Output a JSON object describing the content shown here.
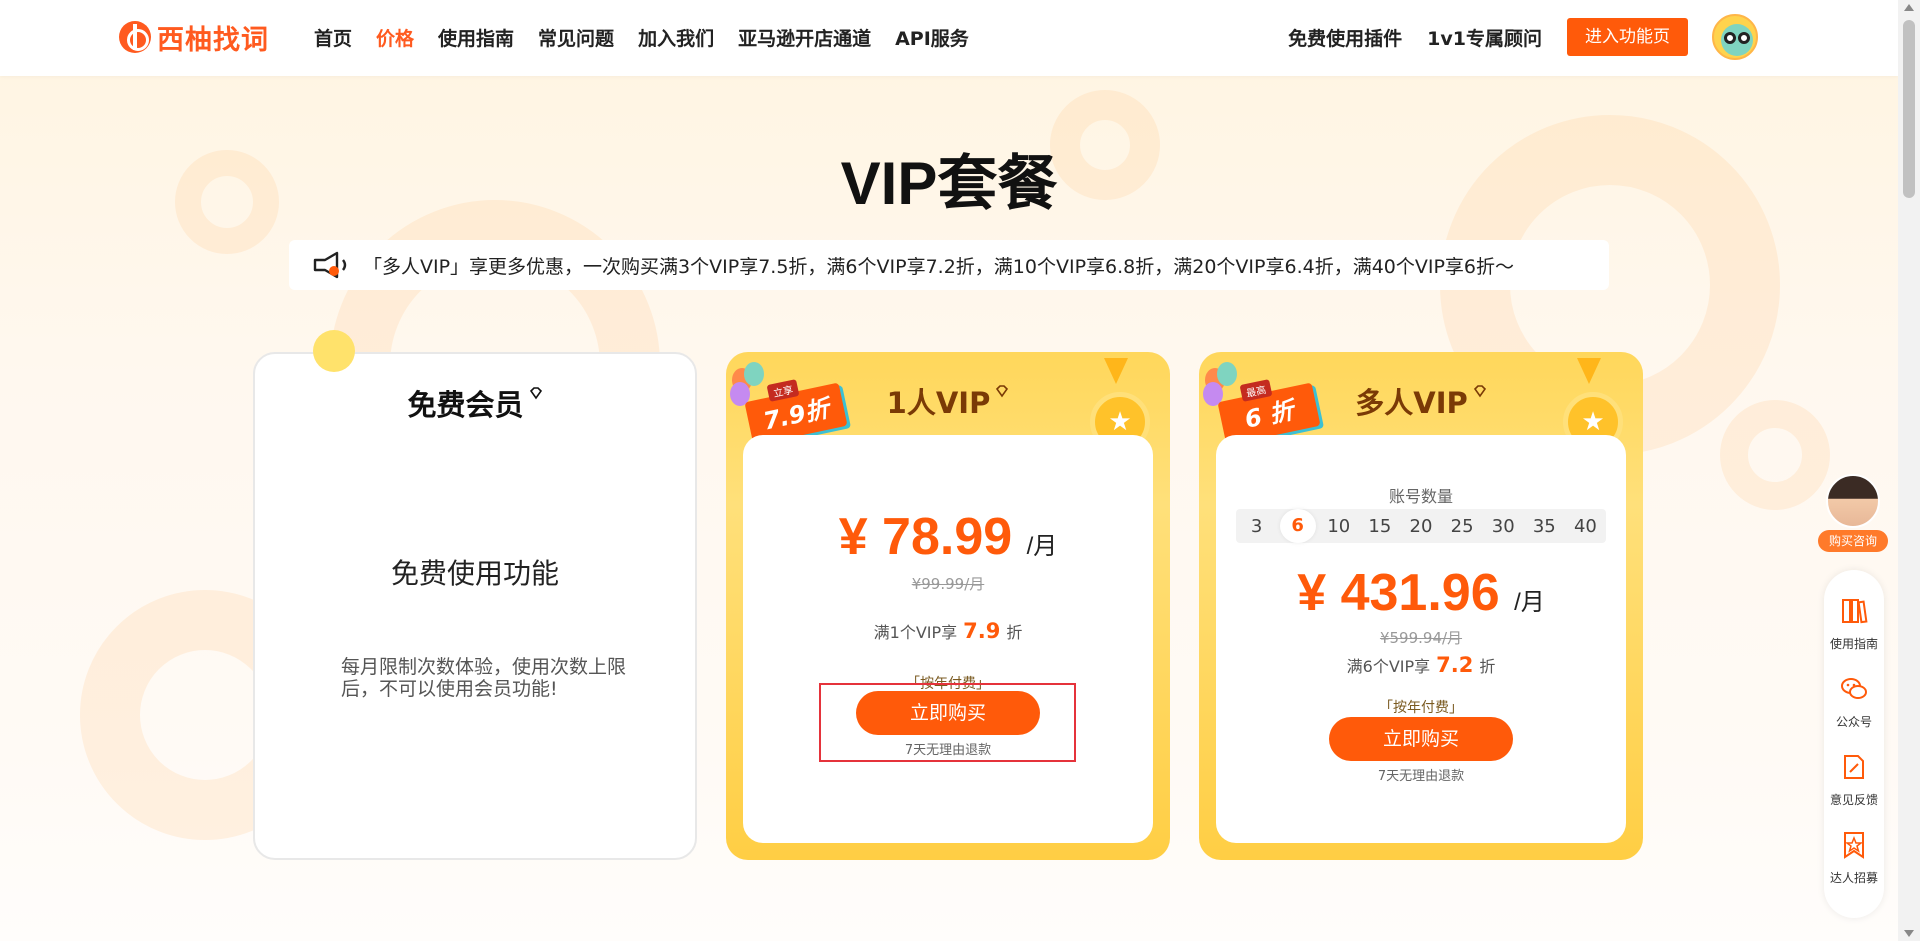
{
  "brand": {
    "name": "西柚找词",
    "color": "#ff5a1f"
  },
  "nav": {
    "items": [
      "首页",
      "价格",
      "使用指南",
      "常见问题",
      "加入我们",
      "亚马逊开店通道",
      "API服务"
    ],
    "active_index": 1
  },
  "header_right": {
    "plugin_link": "免费使用插件",
    "advisor_link": "1v1专属顾问",
    "enter_button": "进入功能页"
  },
  "page_title": "VIP套餐",
  "notice": {
    "icon": "megaphone-icon",
    "text": "「多人VIP」享更多优惠，一次购买满3个VIP享7.5折，满6个VIP享7.2折，满10个VIP享6.8折，满20个VIP享6.4折，满40个VIP享6折～"
  },
  "plans": {
    "free": {
      "title": "免费会员",
      "main": "免费使用功能",
      "desc": "每月限制次数体验，使用次数上限后，不可以使用会员功能!"
    },
    "single": {
      "title": "1人VIP",
      "ribbon_tag": "立享",
      "ribbon": "7.9折",
      "price": "¥ 78.99",
      "unit": "/月",
      "original": "¥99.99/月",
      "discount_prefix": "满1个VIP享",
      "discount_value": "7.9",
      "discount_suffix": "折",
      "pay_type": "「按年付费」",
      "buy_button": "立即购买",
      "refund": "7天无理由退款"
    },
    "multi": {
      "title": "多人VIP",
      "ribbon_tag": "最高",
      "ribbon": "6 折",
      "account_label": "账号数量",
      "account_options": [
        "3",
        "6",
        "10",
        "15",
        "20",
        "25",
        "30",
        "35",
        "40"
      ],
      "account_selected": "6",
      "price": "¥ 431.96",
      "unit": "/月",
      "original": "¥599.94/月",
      "discount_prefix": "满6个VIP享",
      "discount_value": "7.2",
      "discount_suffix": "折",
      "pay_type": "「按年付费」",
      "buy_button": "立即购买",
      "refund": "7天无理由退款"
    }
  },
  "sidebar": {
    "consult_label": "购买咨询",
    "tools": [
      {
        "label": "使用指南",
        "icon": "book-icon"
      },
      {
        "label": "公众号",
        "icon": "wechat-icon"
      },
      {
        "label": "意见反馈",
        "icon": "feedback-icon"
      },
      {
        "label": "达人招募",
        "icon": "star-badge-icon"
      }
    ]
  },
  "colors": {
    "accent": "#ff5a0a",
    "vip_gold": "#ffd75b",
    "highlight": "#e5333b"
  }
}
